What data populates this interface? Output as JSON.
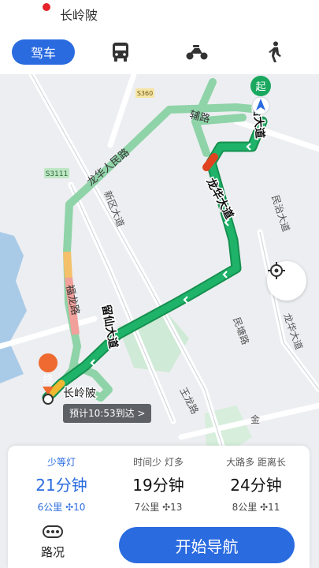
{
  "header": {
    "destination": "长岭陂"
  },
  "modes": [
    {
      "label": "驾车",
      "icon": "car"
    },
    {
      "label": "",
      "icon": "bus-icon"
    },
    {
      "label": "",
      "icon": "scooter-icon"
    },
    {
      "label": "",
      "icon": "walk-icon"
    }
  ],
  "map": {
    "start_marker": "起",
    "end_marker": "终",
    "end_label": "长岭陂",
    "eta_label": "预计10:53到达 >",
    "road_labels": {
      "s360": "S360",
      "s3111": "S3111",
      "fulu": "辅路",
      "minzhi_top": "治大道",
      "longhua_renmin": "龙华人民路",
      "xinqu": "新区大道",
      "longhua_main": "龙华大道",
      "minzhi": "民治大道",
      "fulong": "福龙路",
      "liuxian": "留仙大道",
      "mintang": "民塘路",
      "longhua_right": "龙华大道",
      "wanglong": "王龙路",
      "jin": "金"
    }
  },
  "routes": [
    {
      "tags": "少等灯",
      "time": "21分钟",
      "distance": "6公里",
      "lights": "10"
    },
    {
      "tags": "时间少  灯多",
      "time": "19分钟",
      "distance": "7公里",
      "lights": "13"
    },
    {
      "tags": "大路多  距离长",
      "time": "24分钟",
      "distance": "8公里",
      "lights": "11"
    }
  ],
  "actions": {
    "traffic_label": "路况",
    "start_nav": "开始导航"
  },
  "colors": {
    "accent": "#2a6be0",
    "route_green": "#1aa85f",
    "alt_route": "#8fd3a8",
    "congestion_red": "#f2a09b"
  }
}
